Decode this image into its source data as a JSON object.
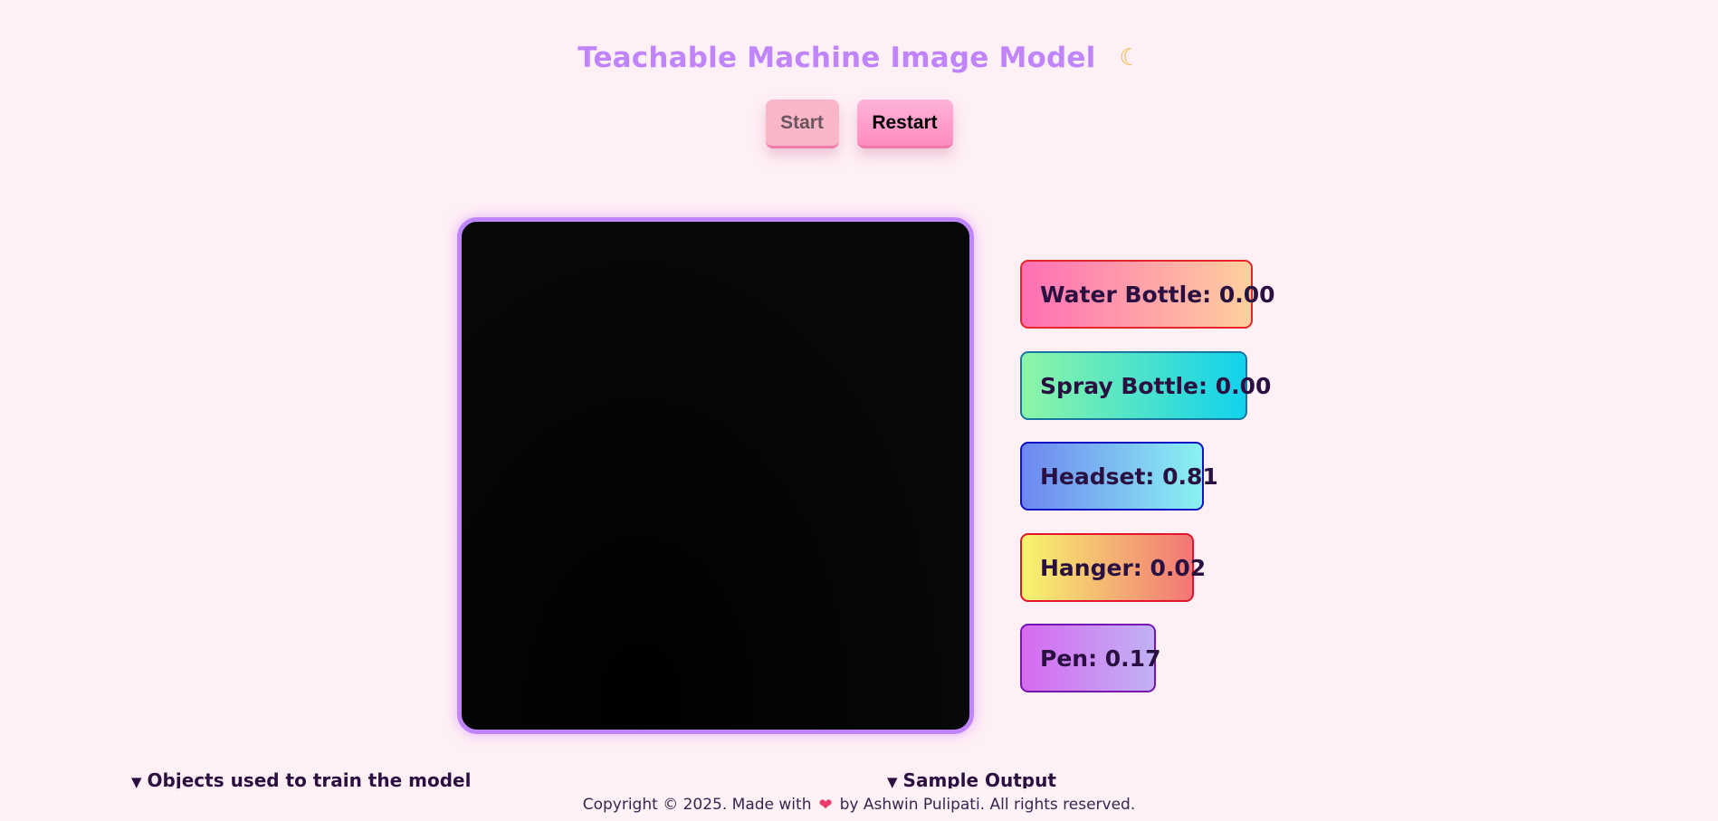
{
  "header": {
    "title": "Teachable Machine Image Model",
    "theme_icon": "☾",
    "theme_icon_name": "moon-icon"
  },
  "controls": {
    "start_label": "Start",
    "restart_label": "Restart"
  },
  "predictions": [
    {
      "text": "Water Bottle: 0.00",
      "label": "Water Bottle",
      "value": 0.0
    },
    {
      "text": "Spray Bottle: 0.00",
      "label": "Spray Bottle",
      "value": 0.0
    },
    {
      "text": "Headset: 0.81",
      "label": "Headset",
      "value": 0.81
    },
    {
      "text": "Hanger: 0.02",
      "label": "Hanger",
      "value": 0.02
    },
    {
      "text": "Pen: 0.17",
      "label": "Pen",
      "value": 0.17
    }
  ],
  "sections": {
    "objects_summary": "Objects used to train the model",
    "sample_summary": "Sample Output",
    "caret_icon": "▼"
  },
  "footer": {
    "prefix": "Copyright © 2025. Made with",
    "heart": "❤",
    "suffix": "by Ashwin Pulipati. All rights reserved."
  },
  "colors": {
    "background": "#fff0f5",
    "accent": "#c084fc",
    "restart_button": "#ff8cc0",
    "start_button": "#f9b6c6"
  }
}
